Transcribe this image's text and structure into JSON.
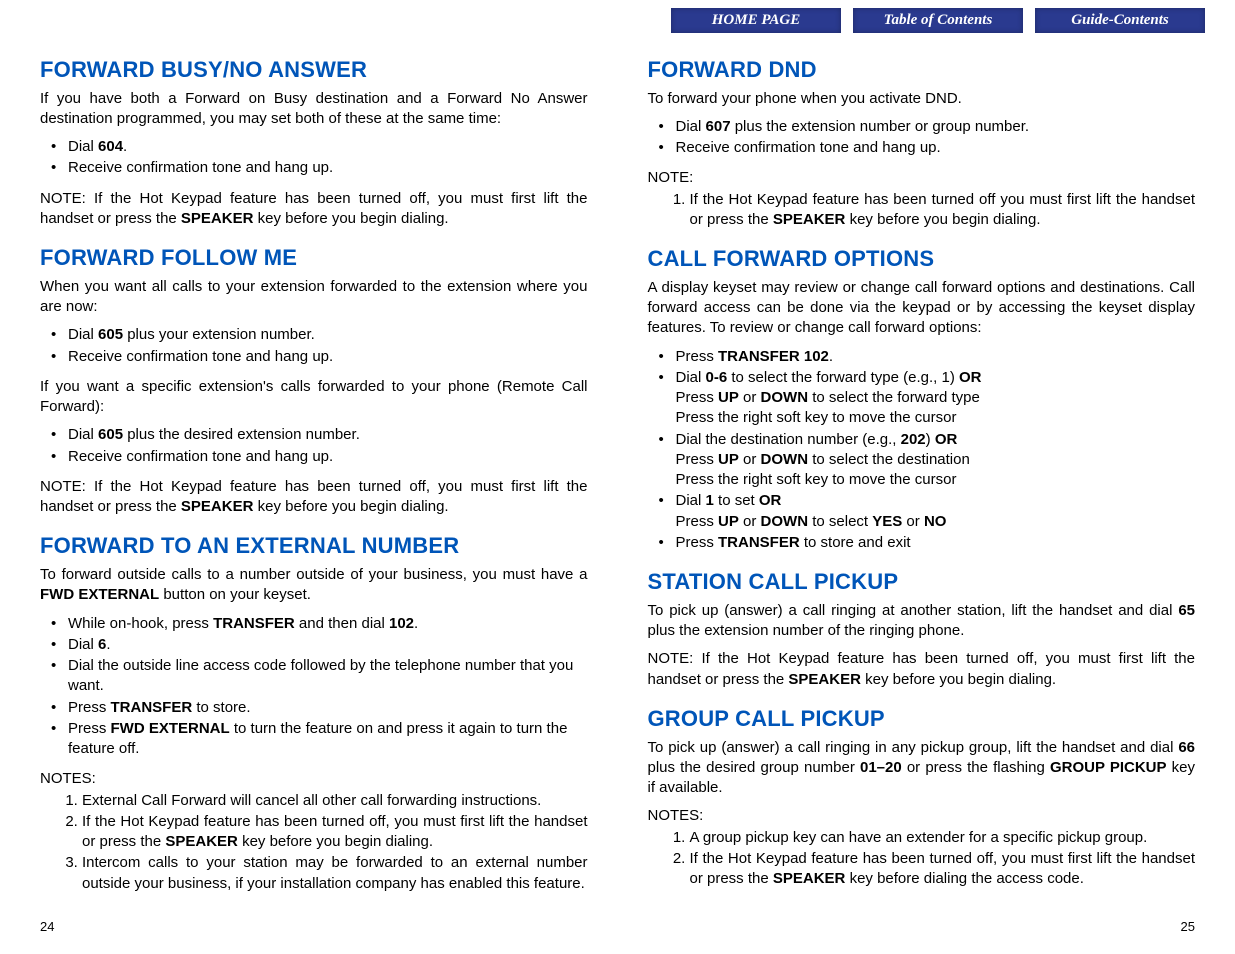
{
  "nav": {
    "home": "HOME PAGE",
    "toc": "Table of Contents",
    "guide": "Guide-Contents"
  },
  "left": {
    "s1": {
      "title": "FORWARD BUSY/NO ANSWER",
      "p1_a": "If you have both a Forward on Busy destination and a Forward No Answer destination programmed, you may set both of these at the same time:",
      "li1_a": "Dial ",
      "li1_b": "604",
      "li1_c": ".",
      "li2": "Receive confirmation tone and hang up.",
      "note_a": "NOTE:  If the Hot Keypad feature has been turned off, you must first lift the handset or press the ",
      "note_b": "SPEAKER",
      "note_c": " key before you begin dialing."
    },
    "s2": {
      "title": "FORWARD FOLLOW ME",
      "p1": "When you want all calls to your extension forwarded to the extension where you are now:",
      "li1_a": "Dial ",
      "li1_b": "605",
      "li1_c": " plus your extension number.",
      "li2": "Receive confirmation tone and hang up.",
      "p2": "If you want a specific extension's calls forwarded to your phone (Remote Call Forward):",
      "li3_a": "Dial ",
      "li3_b": "605",
      "li3_c": " plus the desired extension number.",
      "li4": "Receive confirmation tone and hang up.",
      "note_a": "NOTE:  If the Hot Keypad feature has been turned off, you must first lift the handset or press the ",
      "note_b": "SPEAKER",
      "note_c": " key before you begin dialing."
    },
    "s3": {
      "title": "FORWARD TO AN EXTERNAL NUMBER",
      "p1_a": "To forward outside calls to a number outside of your business, you must have a ",
      "p1_b": "FWD EXTERNAL",
      "p1_c": " button on your keyset.",
      "li1_a": "While on-hook, press ",
      "li1_b": "TRANSFER",
      "li1_c": " and then dial ",
      "li1_d": "102",
      "li1_e": ".",
      "li2_a": "Dial ",
      "li2_b": "6",
      "li2_c": ".",
      "li3": "Dial the outside line access code followed by the telephone number that you want.",
      "li4_a": "Press ",
      "li4_b": "TRANSFER",
      "li4_c": " to store.",
      "li5_a": "Press ",
      "li5_b": "FWD EXTERNAL",
      "li5_c": " to turn the feature on and press it again to turn the feature off.",
      "notes_label": "NOTES:",
      "n1": "External Call Forward will cancel all other call forwarding instructions.",
      "n2_a": "If the Hot Keypad feature has been turned off, you must first lift the handset or press the ",
      "n2_b": "SPEAKER",
      "n2_c": " key before you begin dialing.",
      "n3": "Intercom calls to your station may be forwarded to an external number outside your business, if your installation company has enabled this feature."
    },
    "pagenum": "24"
  },
  "right": {
    "s1": {
      "title": "FORWARD DND",
      "p1": "To forward your phone when you activate DND.",
      "li1_a": "Dial ",
      "li1_b": "607",
      "li1_c": " plus the extension number or group number.",
      "li2": "Receive confirmation tone and hang up.",
      "note_label": "NOTE:",
      "n1_a": "If the Hot Keypad feature has been turned off you must first lift the handset or press the ",
      "n1_b": "SPEAKER",
      "n1_c": " key before you begin dialing."
    },
    "s2": {
      "title": "CALL FORWARD OPTIONS",
      "p1": "A display keyset may review or change call forward options and destinations. Call forward access can be done via the keypad or by accessing the keyset display features. To review or change call forward options:",
      "li1_a": "Press ",
      "li1_b": "TRANSFER 102",
      "li1_c": ".",
      "li2_a": "Dial ",
      "li2_b": "0-6",
      "li2_c": " to select the forward type (e.g., 1) ",
      "li2_d": "OR",
      "li2_e": "Press ",
      "li2_f": "UP",
      "li2_g": " or ",
      "li2_h": "DOWN",
      "li2_i": " to select the forward type",
      "li2_j": "Press the right soft key to move the cursor",
      "li3_a": "Dial the destination number (e.g., ",
      "li3_b": "202",
      "li3_c": ") ",
      "li3_d": "OR",
      "li3_e": "Press ",
      "li3_f": "UP",
      "li3_g": " or ",
      "li3_h": "DOWN",
      "li3_i": " to select the destination",
      "li3_j": "Press the right soft key to move the cursor",
      "li4_a": "Dial ",
      "li4_b": "1",
      "li4_c": " to set ",
      "li4_d": "OR",
      "li4_e": "Press ",
      "li4_f": "UP",
      "li4_g": " or ",
      "li4_h": "DOWN",
      "li4_i": " to select ",
      "li4_j": "YES",
      "li4_k": " or ",
      "li4_l": "NO",
      "li5_a": "Press ",
      "li5_b": "TRANSFER",
      "li5_c": " to store and exit"
    },
    "s3": {
      "title": "STATION CALL PICKUP",
      "p1_a": "To pick up (answer) a call ringing at another station, lift the handset and dial ",
      "p1_b": "65",
      "p1_c": " plus the extension number of the ringing phone.",
      "note_a": "NOTE:  If the Hot Keypad feature has been turned off, you must first lift the handset or press the ",
      "note_b": "SPEAKER",
      "note_c": " key before you begin dialing."
    },
    "s4": {
      "title": "GROUP CALL PICKUP",
      "p1_a": "To pick up (answer) a call ringing in any pickup group, lift the handset and dial ",
      "p1_b": "66",
      "p1_c": " plus the desired group number ",
      "p1_d": "01–20",
      "p1_e": " or press the flashing ",
      "p1_f": "GROUP PICKUP",
      "p1_g": " key if available.",
      "notes_label": "NOTES:",
      "n1": "A group pickup key can have an extender for a specific pickup group.",
      "n2_a": "If the Hot Keypad feature has been turned off, you must first lift the handset or press the ",
      "n2_b": "SPEAKER",
      "n2_c": " key before dialing the access code."
    },
    "pagenum": "25"
  }
}
